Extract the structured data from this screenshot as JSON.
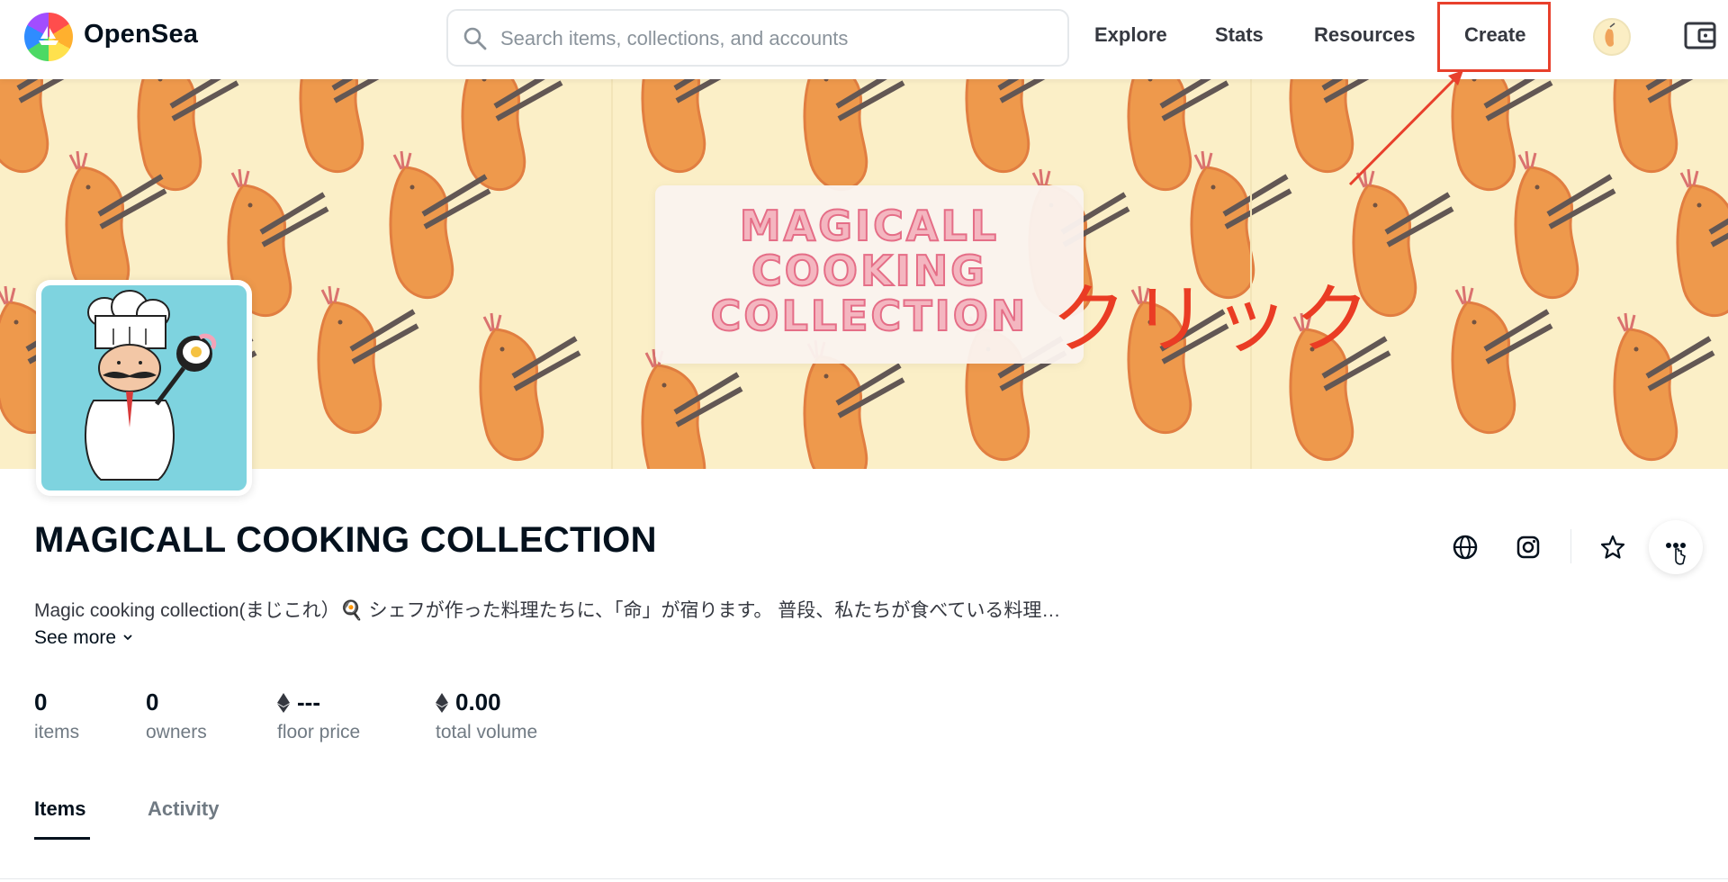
{
  "nav": {
    "brand": "OpenSea",
    "search_placeholder": "Search items, collections, and accounts",
    "links": [
      "Explore",
      "Stats",
      "Resources",
      "Create"
    ]
  },
  "banner": {
    "title": "MAGICALL\nCOOKING\nCOLLECTION",
    "annotation": "クリック"
  },
  "collection": {
    "title": "MAGICALL COOKING COLLECTION",
    "description": "Magic cooking collection(まじこれ）🍳 シェフが作った料理たちに、「命」が宿ります。 普段、私たちが食べている料理…",
    "see_more": "See more",
    "stats": [
      {
        "value": "0",
        "label": "items",
        "eth": false
      },
      {
        "value": "0",
        "label": "owners",
        "eth": false
      },
      {
        "value": "---",
        "label": "floor price",
        "eth": true
      },
      {
        "value": "0.00",
        "label": "total volume",
        "eth": true
      }
    ]
  },
  "tabs": [
    "Items",
    "Activity"
  ],
  "colors": {
    "annotation_red": "#e8402c",
    "banner_bg": "#fbefc7",
    "avatar_bg": "#7ed3df",
    "text_dark": "#04111d",
    "text_muted": "#707a83"
  },
  "icons": [
    "search-icon",
    "wallet-icon",
    "globe-icon",
    "instagram-icon",
    "star-icon",
    "more-icon",
    "chevron-down-icon",
    "eth-icon",
    "cursor-hand-icon"
  ]
}
